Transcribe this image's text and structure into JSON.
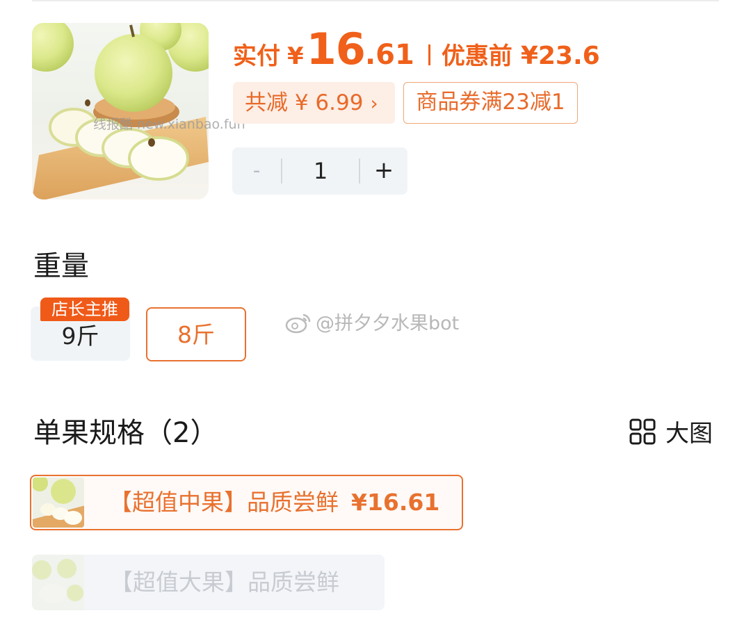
{
  "product": {
    "price_label": "实付",
    "price_currency": "¥",
    "price_integer": "16",
    "price_decimal": ".61",
    "original_label": "优惠前",
    "original_price": "¥23.6",
    "discount_tag": "共减 ¥ 6.99",
    "coupon_tag": "商品券满23减1",
    "watermark": "线报酷 new.xianbao.fun"
  },
  "stepper": {
    "minus": "-",
    "quantity": "1",
    "plus": "+"
  },
  "weight": {
    "title": "重量",
    "badge": "店长主推",
    "options": [
      "9斤",
      "8斤"
    ],
    "selected": "8斤"
  },
  "watermark2": "@拼夕夕水果bot",
  "spec": {
    "title": "单果规格（2）",
    "big_view_label": "大图",
    "items": [
      {
        "label": "【超值中果】品质尝鲜",
        "price": "¥16.61",
        "selected": true
      },
      {
        "label": "【超值大果】品质尝鲜",
        "price": "",
        "selected": false
      }
    ]
  },
  "colors": {
    "accent": "#f0601a",
    "selected_border": "#e8712f",
    "option_bg": "#f1f4f7",
    "badge_bg": "#f05a18"
  }
}
